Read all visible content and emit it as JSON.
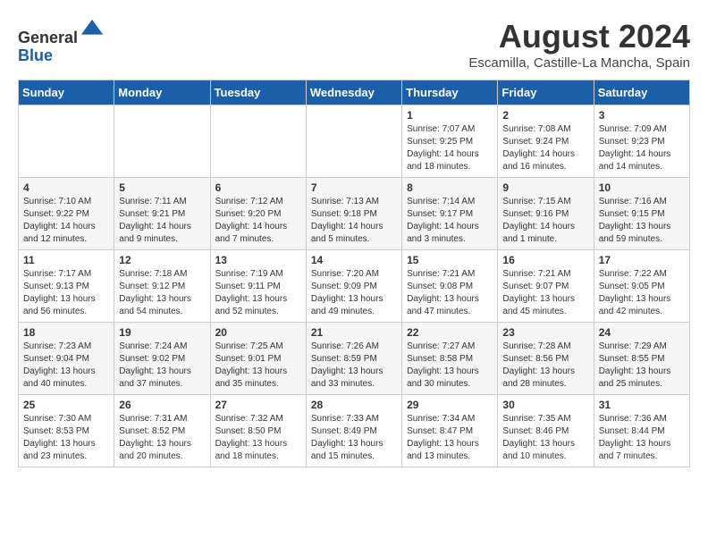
{
  "header": {
    "logo_line1": "General",
    "logo_line2": "Blue",
    "month": "August 2024",
    "location": "Escamilla, Castille-La Mancha, Spain"
  },
  "weekdays": [
    "Sunday",
    "Monday",
    "Tuesday",
    "Wednesday",
    "Thursday",
    "Friday",
    "Saturday"
  ],
  "weeks": [
    [
      {
        "day": "",
        "info": ""
      },
      {
        "day": "",
        "info": ""
      },
      {
        "day": "",
        "info": ""
      },
      {
        "day": "",
        "info": ""
      },
      {
        "day": "1",
        "info": "Sunrise: 7:07 AM\nSunset: 9:25 PM\nDaylight: 14 hours\nand 18 minutes."
      },
      {
        "day": "2",
        "info": "Sunrise: 7:08 AM\nSunset: 9:24 PM\nDaylight: 14 hours\nand 16 minutes."
      },
      {
        "day": "3",
        "info": "Sunrise: 7:09 AM\nSunset: 9:23 PM\nDaylight: 14 hours\nand 14 minutes."
      }
    ],
    [
      {
        "day": "4",
        "info": "Sunrise: 7:10 AM\nSunset: 9:22 PM\nDaylight: 14 hours\nand 12 minutes."
      },
      {
        "day": "5",
        "info": "Sunrise: 7:11 AM\nSunset: 9:21 PM\nDaylight: 14 hours\nand 9 minutes."
      },
      {
        "day": "6",
        "info": "Sunrise: 7:12 AM\nSunset: 9:20 PM\nDaylight: 14 hours\nand 7 minutes."
      },
      {
        "day": "7",
        "info": "Sunrise: 7:13 AM\nSunset: 9:18 PM\nDaylight: 14 hours\nand 5 minutes."
      },
      {
        "day": "8",
        "info": "Sunrise: 7:14 AM\nSunset: 9:17 PM\nDaylight: 14 hours\nand 3 minutes."
      },
      {
        "day": "9",
        "info": "Sunrise: 7:15 AM\nSunset: 9:16 PM\nDaylight: 14 hours\nand 1 minute."
      },
      {
        "day": "10",
        "info": "Sunrise: 7:16 AM\nSunset: 9:15 PM\nDaylight: 13 hours\nand 59 minutes."
      }
    ],
    [
      {
        "day": "11",
        "info": "Sunrise: 7:17 AM\nSunset: 9:13 PM\nDaylight: 13 hours\nand 56 minutes."
      },
      {
        "day": "12",
        "info": "Sunrise: 7:18 AM\nSunset: 9:12 PM\nDaylight: 13 hours\nand 54 minutes."
      },
      {
        "day": "13",
        "info": "Sunrise: 7:19 AM\nSunset: 9:11 PM\nDaylight: 13 hours\nand 52 minutes."
      },
      {
        "day": "14",
        "info": "Sunrise: 7:20 AM\nSunset: 9:09 PM\nDaylight: 13 hours\nand 49 minutes."
      },
      {
        "day": "15",
        "info": "Sunrise: 7:21 AM\nSunset: 9:08 PM\nDaylight: 13 hours\nand 47 minutes."
      },
      {
        "day": "16",
        "info": "Sunrise: 7:21 AM\nSunset: 9:07 PM\nDaylight: 13 hours\nand 45 minutes."
      },
      {
        "day": "17",
        "info": "Sunrise: 7:22 AM\nSunset: 9:05 PM\nDaylight: 13 hours\nand 42 minutes."
      }
    ],
    [
      {
        "day": "18",
        "info": "Sunrise: 7:23 AM\nSunset: 9:04 PM\nDaylight: 13 hours\nand 40 minutes."
      },
      {
        "day": "19",
        "info": "Sunrise: 7:24 AM\nSunset: 9:02 PM\nDaylight: 13 hours\nand 37 minutes."
      },
      {
        "day": "20",
        "info": "Sunrise: 7:25 AM\nSunset: 9:01 PM\nDaylight: 13 hours\nand 35 minutes."
      },
      {
        "day": "21",
        "info": "Sunrise: 7:26 AM\nSunset: 8:59 PM\nDaylight: 13 hours\nand 33 minutes."
      },
      {
        "day": "22",
        "info": "Sunrise: 7:27 AM\nSunset: 8:58 PM\nDaylight: 13 hours\nand 30 minutes."
      },
      {
        "day": "23",
        "info": "Sunrise: 7:28 AM\nSunset: 8:56 PM\nDaylight: 13 hours\nand 28 minutes."
      },
      {
        "day": "24",
        "info": "Sunrise: 7:29 AM\nSunset: 8:55 PM\nDaylight: 13 hours\nand 25 minutes."
      }
    ],
    [
      {
        "day": "25",
        "info": "Sunrise: 7:30 AM\nSunset: 8:53 PM\nDaylight: 13 hours\nand 23 minutes."
      },
      {
        "day": "26",
        "info": "Sunrise: 7:31 AM\nSunset: 8:52 PM\nDaylight: 13 hours\nand 20 minutes."
      },
      {
        "day": "27",
        "info": "Sunrise: 7:32 AM\nSunset: 8:50 PM\nDaylight: 13 hours\nand 18 minutes."
      },
      {
        "day": "28",
        "info": "Sunrise: 7:33 AM\nSunset: 8:49 PM\nDaylight: 13 hours\nand 15 minutes."
      },
      {
        "day": "29",
        "info": "Sunrise: 7:34 AM\nSunset: 8:47 PM\nDaylight: 13 hours\nand 13 minutes."
      },
      {
        "day": "30",
        "info": "Sunrise: 7:35 AM\nSunset: 8:46 PM\nDaylight: 13 hours\nand 10 minutes."
      },
      {
        "day": "31",
        "info": "Sunrise: 7:36 AM\nSunset: 8:44 PM\nDaylight: 13 hours\nand 7 minutes."
      }
    ]
  ]
}
